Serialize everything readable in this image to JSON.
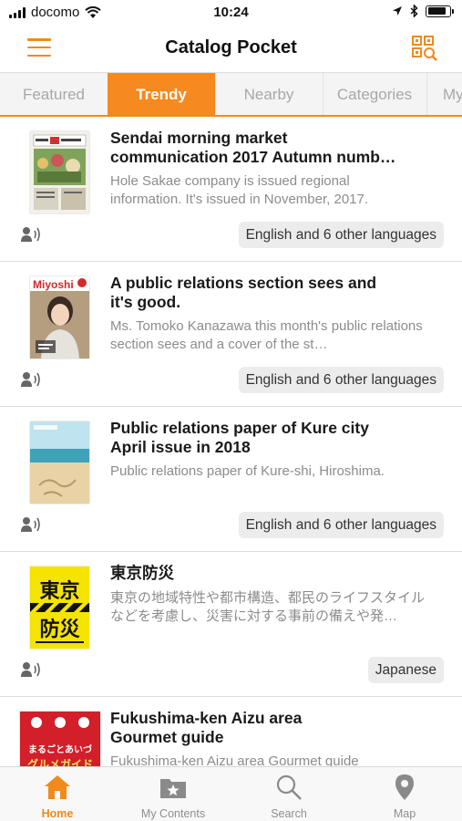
{
  "status_bar": {
    "carrier": "docomo",
    "time": "10:24",
    "battery_level": 0.85,
    "icons": [
      "signal-icon",
      "wifi-icon",
      "location-icon",
      "bluetooth-icon",
      "battery-icon"
    ]
  },
  "nav": {
    "title": "Catalog Pocket",
    "menu_icon": "hamburger-menu-icon",
    "qr_icon": "qr-scan-icon",
    "accent_color": "#f08a1c"
  },
  "tabs": [
    {
      "label": "Featured",
      "active": false
    },
    {
      "label": "Trendy",
      "active": true
    },
    {
      "label": "Nearby",
      "active": false
    },
    {
      "label": "Categories",
      "active": false
    },
    {
      "label": "My",
      "active": false
    }
  ],
  "items": [
    {
      "title": "Sendai morning market\ncommunication  2017  Autumn numb…",
      "description": "Hole Sakae company is issued regional information. It's issued in November, 2017.",
      "language": "English and 6 other languages",
      "audio_icon": "audio-guide-icon"
    },
    {
      "title": "A public relations section sees and\nit's good.",
      "description": "Ms. Tomoko Kanazawa this month's public relations section sees and a cover of the st…",
      "language": "English and 6 other languages",
      "audio_icon": "audio-guide-icon",
      "cover_text": "Miyoshi"
    },
    {
      "title": "Public relations paper of Kure city\nApril issue in 2018",
      "description": "Public relations paper of Kure-shi, Hiroshima.",
      "language": "English and 6 other languages",
      "audio_icon": "audio-guide-icon"
    },
    {
      "title": "東京防災",
      "description": "東京の地域特性や都市構造、都民のライフスタイルなどを考慮し、災害に対する事前の備えや発…",
      "language": "Japanese",
      "audio_icon": "audio-guide-icon",
      "cover_text": [
        "東京",
        "防災"
      ]
    },
    {
      "title": "Fukushima-ken Aizu area\nGourmet guide",
      "description": "Fukushima-ken Aizu area Gourmet guide",
      "cover_text": [
        "まるごとあいづ",
        "グルメガイド"
      ]
    }
  ],
  "bottom_tabs": [
    {
      "label": "Home",
      "icon": "home-icon",
      "active": true
    },
    {
      "label": "My Contents",
      "icon": "folder-star-icon",
      "active": false
    },
    {
      "label": "Search",
      "icon": "search-icon",
      "active": false
    },
    {
      "label": "Map",
      "icon": "map-pin-icon",
      "active": false
    }
  ]
}
